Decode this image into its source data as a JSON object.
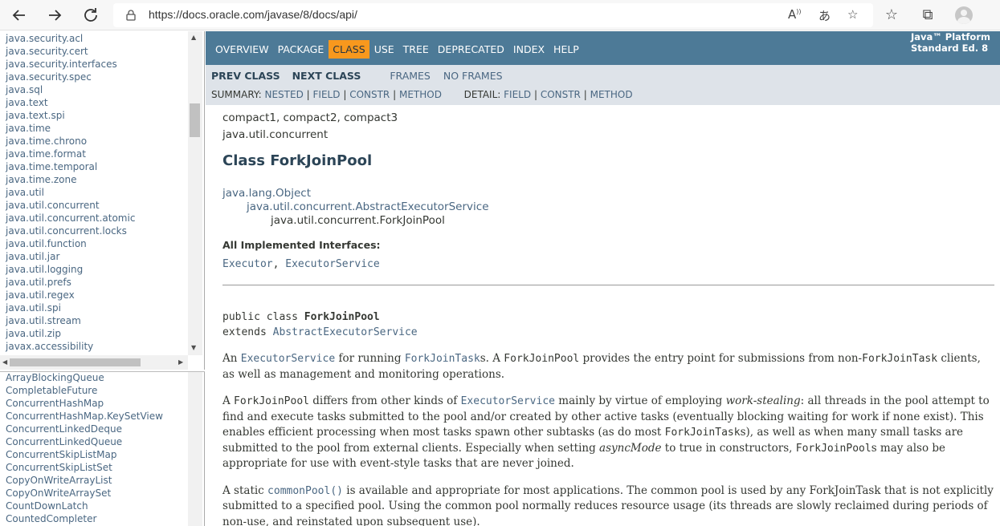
{
  "browser": {
    "url": "https://docs.oracle.com/javase/8/docs/api/",
    "icons": [
      "back-icon",
      "forward-icon",
      "refresh-icon",
      "lock-icon",
      "read-aloud-icon",
      "translate-icon",
      "add-favorite-icon",
      "favorites-icon",
      "collections-icon",
      "profile-avatar"
    ]
  },
  "packages": [
    "java.security.acl",
    "java.security.cert",
    "java.security.interfaces",
    "java.security.spec",
    "java.sql",
    "java.text",
    "java.text.spi",
    "java.time",
    "java.time.chrono",
    "java.time.format",
    "java.time.temporal",
    "java.time.zone",
    "java.util",
    "java.util.concurrent",
    "java.util.concurrent.atomic",
    "java.util.concurrent.locks",
    "java.util.function",
    "java.util.jar",
    "java.util.logging",
    "java.util.prefs",
    "java.util.regex",
    "java.util.spi",
    "java.util.stream",
    "java.util.zip",
    "javax.accessibility"
  ],
  "classes": [
    "ArrayBlockingQueue",
    "CompletableFuture",
    "ConcurrentHashMap",
    "ConcurrentHashMap.KeySetView",
    "ConcurrentLinkedDeque",
    "ConcurrentLinkedQueue",
    "ConcurrentSkipListMap",
    "ConcurrentSkipListSet",
    "CopyOnWriteArrayList",
    "CopyOnWriteArraySet",
    "CountDownLatch",
    "CountedCompleter"
  ],
  "topnav": {
    "overview": "OVERVIEW",
    "package": "PACKAGE",
    "class": "CLASS",
    "use": "USE",
    "tree": "TREE",
    "deprecated": "DEPRECATED",
    "index": "INDEX",
    "help": "HELP",
    "about_line1": "Java™ Platform",
    "about_line2": "Standard Ed. 8"
  },
  "subnav": {
    "prev_class": "PREV CLASS",
    "next_class": "NEXT CLASS",
    "frames": "FRAMES",
    "no_frames": "NO FRAMES",
    "summary_label": "SUMMARY:",
    "nested": "NESTED",
    "field": "FIELD",
    "constr": "CONSTR",
    "method": "METHOD",
    "detail_label": "DETAIL:",
    "d_field": "FIELD",
    "d_constr": "CONSTR",
    "d_method": "METHOD",
    "sep": "|"
  },
  "content": {
    "profiles": "compact1, compact2, compact3",
    "package": "java.util.concurrent",
    "title": "Class ForkJoinPool",
    "inherit1": "java.lang.Object",
    "inherit2": "java.util.concurrent.AbstractExecutorService",
    "inherit3": "java.util.concurrent.ForkJoinPool",
    "impl_label": "All Implemented Interfaces:",
    "impl1": "Executor",
    "impl_sep": ", ",
    "impl2": "ExecutorService",
    "sig_public": "public class ",
    "sig_name": "ForkJoinPool",
    "sig_extends": "extends ",
    "sig_super": "AbstractExecutorService",
    "p1": {
      "a": "An ",
      "b": "ExecutorService",
      "c": " for running ",
      "d": "ForkJoinTask",
      "e": "s. A ",
      "f": "ForkJoinPool",
      "g": " provides the entry point for submissions from non-",
      "h": "ForkJoinTask",
      "i": " clients, as well as management and monitoring operations."
    },
    "p2": {
      "a": "A ",
      "b": "ForkJoinPool",
      "c": " differs from other kinds of ",
      "d": "ExecutorService",
      "e": " mainly by virtue of employing ",
      "f": "work-stealing",
      "g": ": all threads in the pool attempt to find and execute tasks submitted to the pool and/or created by other active tasks (eventually blocking waiting for work if none exist). This enables efficient processing when most tasks spawn other subtasks (as do most ",
      "h": "ForkJoinTask",
      "i": "s), as well as when many small tasks are submitted to the pool from external clients. Especially when setting ",
      "j": "asyncMode",
      "k": " to true in constructors, ",
      "l": "ForkJoinPool",
      "m": "s may also be appropriate for use with event-style tasks that are never joined."
    },
    "p3": {
      "a": "A static ",
      "b": "commonPool()",
      "c": " is available and appropriate for most applications. The common pool is used by any ForkJoinTask that is not explicitly submitted to a specified pool. Using the common pool normally reduces resource usage (its threads are slowly reclaimed during periods of non-use, and reinstated upon subsequent use)."
    }
  }
}
